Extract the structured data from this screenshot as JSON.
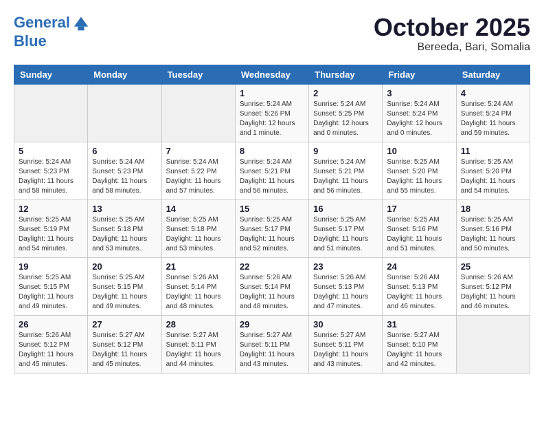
{
  "header": {
    "logo_line1": "General",
    "logo_line2": "Blue",
    "title": "October 2025",
    "subtitle": "Bereeda, Bari, Somalia"
  },
  "calendar": {
    "weekdays": [
      "Sunday",
      "Monday",
      "Tuesday",
      "Wednesday",
      "Thursday",
      "Friday",
      "Saturday"
    ],
    "weeks": [
      [
        {
          "day": "",
          "info": ""
        },
        {
          "day": "",
          "info": ""
        },
        {
          "day": "",
          "info": ""
        },
        {
          "day": "1",
          "info": "Sunrise: 5:24 AM\nSunset: 5:26 PM\nDaylight: 12 hours\nand 1 minute."
        },
        {
          "day": "2",
          "info": "Sunrise: 5:24 AM\nSunset: 5:25 PM\nDaylight: 12 hours\nand 0 minutes."
        },
        {
          "day": "3",
          "info": "Sunrise: 5:24 AM\nSunset: 5:24 PM\nDaylight: 12 hours\nand 0 minutes."
        },
        {
          "day": "4",
          "info": "Sunrise: 5:24 AM\nSunset: 5:24 PM\nDaylight: 11 hours\nand 59 minutes."
        }
      ],
      [
        {
          "day": "5",
          "info": "Sunrise: 5:24 AM\nSunset: 5:23 PM\nDaylight: 11 hours\nand 58 minutes."
        },
        {
          "day": "6",
          "info": "Sunrise: 5:24 AM\nSunset: 5:23 PM\nDaylight: 11 hours\nand 58 minutes."
        },
        {
          "day": "7",
          "info": "Sunrise: 5:24 AM\nSunset: 5:22 PM\nDaylight: 11 hours\nand 57 minutes."
        },
        {
          "day": "8",
          "info": "Sunrise: 5:24 AM\nSunset: 5:21 PM\nDaylight: 11 hours\nand 56 minutes."
        },
        {
          "day": "9",
          "info": "Sunrise: 5:24 AM\nSunset: 5:21 PM\nDaylight: 11 hours\nand 56 minutes."
        },
        {
          "day": "10",
          "info": "Sunrise: 5:25 AM\nSunset: 5:20 PM\nDaylight: 11 hours\nand 55 minutes."
        },
        {
          "day": "11",
          "info": "Sunrise: 5:25 AM\nSunset: 5:20 PM\nDaylight: 11 hours\nand 54 minutes."
        }
      ],
      [
        {
          "day": "12",
          "info": "Sunrise: 5:25 AM\nSunset: 5:19 PM\nDaylight: 11 hours\nand 54 minutes."
        },
        {
          "day": "13",
          "info": "Sunrise: 5:25 AM\nSunset: 5:18 PM\nDaylight: 11 hours\nand 53 minutes."
        },
        {
          "day": "14",
          "info": "Sunrise: 5:25 AM\nSunset: 5:18 PM\nDaylight: 11 hours\nand 53 minutes."
        },
        {
          "day": "15",
          "info": "Sunrise: 5:25 AM\nSunset: 5:17 PM\nDaylight: 11 hours\nand 52 minutes."
        },
        {
          "day": "16",
          "info": "Sunrise: 5:25 AM\nSunset: 5:17 PM\nDaylight: 11 hours\nand 51 minutes."
        },
        {
          "day": "17",
          "info": "Sunrise: 5:25 AM\nSunset: 5:16 PM\nDaylight: 11 hours\nand 51 minutes."
        },
        {
          "day": "18",
          "info": "Sunrise: 5:25 AM\nSunset: 5:16 PM\nDaylight: 11 hours\nand 50 minutes."
        }
      ],
      [
        {
          "day": "19",
          "info": "Sunrise: 5:25 AM\nSunset: 5:15 PM\nDaylight: 11 hours\nand 49 minutes."
        },
        {
          "day": "20",
          "info": "Sunrise: 5:25 AM\nSunset: 5:15 PM\nDaylight: 11 hours\nand 49 minutes."
        },
        {
          "day": "21",
          "info": "Sunrise: 5:26 AM\nSunset: 5:14 PM\nDaylight: 11 hours\nand 48 minutes."
        },
        {
          "day": "22",
          "info": "Sunrise: 5:26 AM\nSunset: 5:14 PM\nDaylight: 11 hours\nand 48 minutes."
        },
        {
          "day": "23",
          "info": "Sunrise: 5:26 AM\nSunset: 5:13 PM\nDaylight: 11 hours\nand 47 minutes."
        },
        {
          "day": "24",
          "info": "Sunrise: 5:26 AM\nSunset: 5:13 PM\nDaylight: 11 hours\nand 46 minutes."
        },
        {
          "day": "25",
          "info": "Sunrise: 5:26 AM\nSunset: 5:12 PM\nDaylight: 11 hours\nand 46 minutes."
        }
      ],
      [
        {
          "day": "26",
          "info": "Sunrise: 5:26 AM\nSunset: 5:12 PM\nDaylight: 11 hours\nand 45 minutes."
        },
        {
          "day": "27",
          "info": "Sunrise: 5:27 AM\nSunset: 5:12 PM\nDaylight: 11 hours\nand 45 minutes."
        },
        {
          "day": "28",
          "info": "Sunrise: 5:27 AM\nSunset: 5:11 PM\nDaylight: 11 hours\nand 44 minutes."
        },
        {
          "day": "29",
          "info": "Sunrise: 5:27 AM\nSunset: 5:11 PM\nDaylight: 11 hours\nand 43 minutes."
        },
        {
          "day": "30",
          "info": "Sunrise: 5:27 AM\nSunset: 5:11 PM\nDaylight: 11 hours\nand 43 minutes."
        },
        {
          "day": "31",
          "info": "Sunrise: 5:27 AM\nSunset: 5:10 PM\nDaylight: 11 hours\nand 42 minutes."
        },
        {
          "day": "",
          "info": ""
        }
      ]
    ]
  }
}
